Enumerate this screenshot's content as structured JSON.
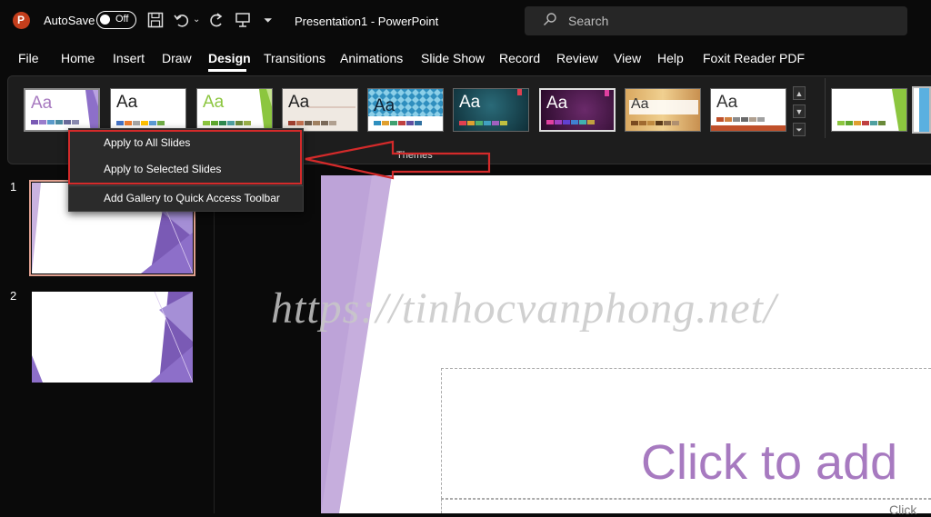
{
  "titlebar": {
    "autosave_label": "AutoSave",
    "autosave_state": "Off",
    "document_title": "Presentation1  -  PowerPoint",
    "search_placeholder": "Search"
  },
  "tabs": [
    "File",
    "Home",
    "Insert",
    "Draw",
    "Design",
    "Transitions",
    "Animations",
    "Slide Show",
    "Record",
    "Review",
    "View",
    "Help",
    "Foxit Reader PDF"
  ],
  "active_tab": "Design",
  "ribbon": {
    "group_label": "Themes",
    "theme_sample_text": "Aa"
  },
  "context_menu": {
    "items": [
      "Apply to All Slides",
      "Apply to Selected Slides",
      "Add Gallery to Quick Access Toolbar"
    ]
  },
  "slides": {
    "numbers": [
      "1",
      "2"
    ]
  },
  "slide": {
    "title_placeholder": "Click to add",
    "subtitle_placeholder": "Click"
  },
  "watermark": "https://tinhocvanphong.net/",
  "colors": {
    "accent_highlight": "#d42a2a",
    "theme_purple": "#a77ac0",
    "app_background": "#0a0a0a"
  }
}
